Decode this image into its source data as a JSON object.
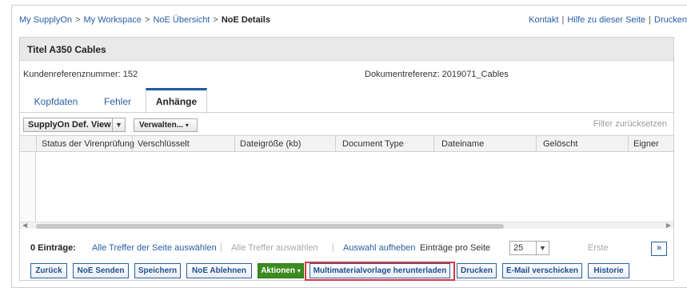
{
  "breadcrumb": {
    "items": [
      "My SupplyOn",
      "My Workspace",
      "NoE Übersicht"
    ],
    "current": "NoE Details",
    "separator": ">"
  },
  "toplinks": {
    "contact": "Kontakt",
    "help": "Hilfe zu dieser Seite",
    "print": "Drucken",
    "separator": "|"
  },
  "header": {
    "title": "Titel A350 Cables"
  },
  "refs": {
    "customer_ref": "Kundenreferenznummer: 152",
    "document_ref": "Dokumentreferenz: 2019071_Cables"
  },
  "tabs": [
    {
      "label": "Kopfdaten",
      "active": false
    },
    {
      "label": "Fehler",
      "active": false
    },
    {
      "label": "Anhänge",
      "active": true
    }
  ],
  "toolbar": {
    "view_select": "SupplyOn Def. View",
    "manage_button": "Verwalten...",
    "filter_reset": "Filter zurücksetzen"
  },
  "grid": {
    "columns": [
      "Status der Virenprüfung",
      "Verschlüsselt",
      "Dateigröße (kb)",
      "Document Type",
      "Dateiname",
      "Gelöscht",
      "Eigner"
    ],
    "rows": []
  },
  "pager": {
    "count": "0 Einträge:",
    "select_page": "Alle Treffer der Seite auswählen",
    "select_all": "Alle Treffer auswählen",
    "deselect": "Auswahl aufheben",
    "per_page_label": "Einträge pro Seite",
    "per_page_value": "25",
    "first": "Erste",
    "next": "»"
  },
  "actions": {
    "back": "Zurück",
    "send": "NoE Senden",
    "save": "Speichern",
    "reject": "NoE Ablehnen",
    "actions_menu": "Aktionen",
    "download_template": "Multimaterialvorlage herunterladen",
    "print": "Drucken",
    "email": "E-Mail verschicken",
    "history": "Historie"
  },
  "colors": {
    "link": "#2a5fa6",
    "actions_green": "#3b8b1f",
    "highlight_red": "#d9373f",
    "active_tab_bar": "#1f5aa0"
  }
}
